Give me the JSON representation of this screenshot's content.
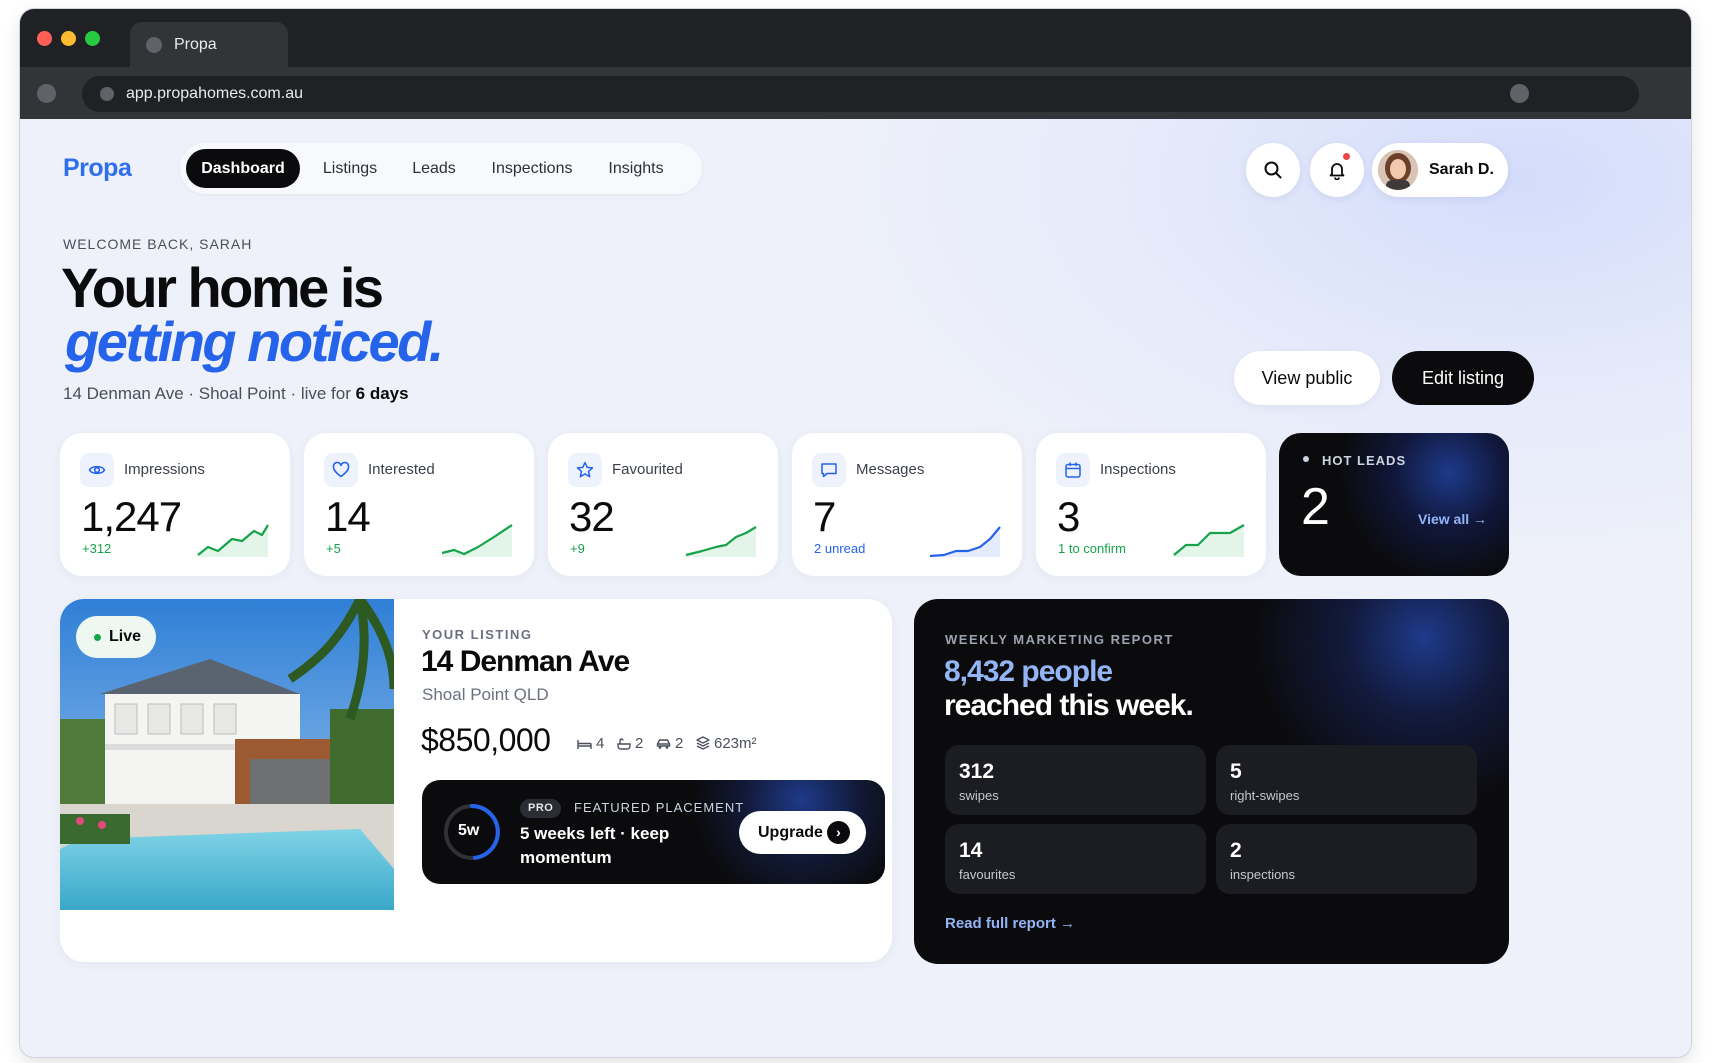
{
  "browser": {
    "tab_title": "Propa",
    "url": "app.propahomes.com.au"
  },
  "header": {
    "brand": "Propa",
    "nav": [
      "Dashboard",
      "Listings",
      "Leads",
      "Inspections",
      "Insights"
    ],
    "active_nav": "Dashboard",
    "user_name": "Sarah D."
  },
  "hero": {
    "eyebrow": "WELCOME BACK, SARAH",
    "title_line1": "Your home is",
    "title_line2": "getting noticed.",
    "subline_prefix": "14 Denman Ave · Shoal Point · live for",
    "subline_bold": "6 days",
    "btn_view_public": "View public",
    "btn_edit_listing": "Edit listing"
  },
  "stats": [
    {
      "label": "Impressions",
      "value": "1,247",
      "delta": "+312",
      "icon": "eye-icon"
    },
    {
      "label": "Interested",
      "value": "14",
      "delta": "+5",
      "icon": "heart-icon"
    },
    {
      "label": "Favourited",
      "value": "32",
      "delta": "+9",
      "icon": "star-icon"
    },
    {
      "label": "Messages",
      "value": "7",
      "delta": "2 unread",
      "icon": "message-icon"
    },
    {
      "label": "Inspections",
      "value": "3",
      "delta": "1 to confirm",
      "icon": "calendar-icon"
    }
  ],
  "hot_leads": {
    "label": "HOT LEADS",
    "value": "2",
    "link": "View all"
  },
  "listing": {
    "badge": "Live",
    "eyebrow": "YOUR LISTING",
    "title": "14 Denman Ave",
    "suburb": "Shoal Point QLD",
    "price": "$850,000",
    "beds": "4",
    "baths": "2",
    "cars": "2",
    "area": "623m²",
    "promo": {
      "ring_label": "5w",
      "badge": "PRO",
      "eyebrow": "FEATURED PLACEMENT",
      "text": "5 weeks left · keep momentum",
      "button": "Upgrade"
    }
  },
  "report": {
    "eyebrow": "WEEKLY MARKETING REPORT",
    "headline_highlight": "8,432 people",
    "headline_rest": "reached this week.",
    "tiles": [
      {
        "value": "312",
        "label": "swipes"
      },
      {
        "value": "5",
        "label": "right-swipes"
      },
      {
        "value": "14",
        "label": "favourites"
      },
      {
        "value": "2",
        "label": "inspections"
      }
    ],
    "link": "Read full report →"
  },
  "colors": {
    "accent": "#2563eb",
    "dark": "#0b0b0d",
    "positive": "#16a34a",
    "notification": "#ef4444"
  }
}
